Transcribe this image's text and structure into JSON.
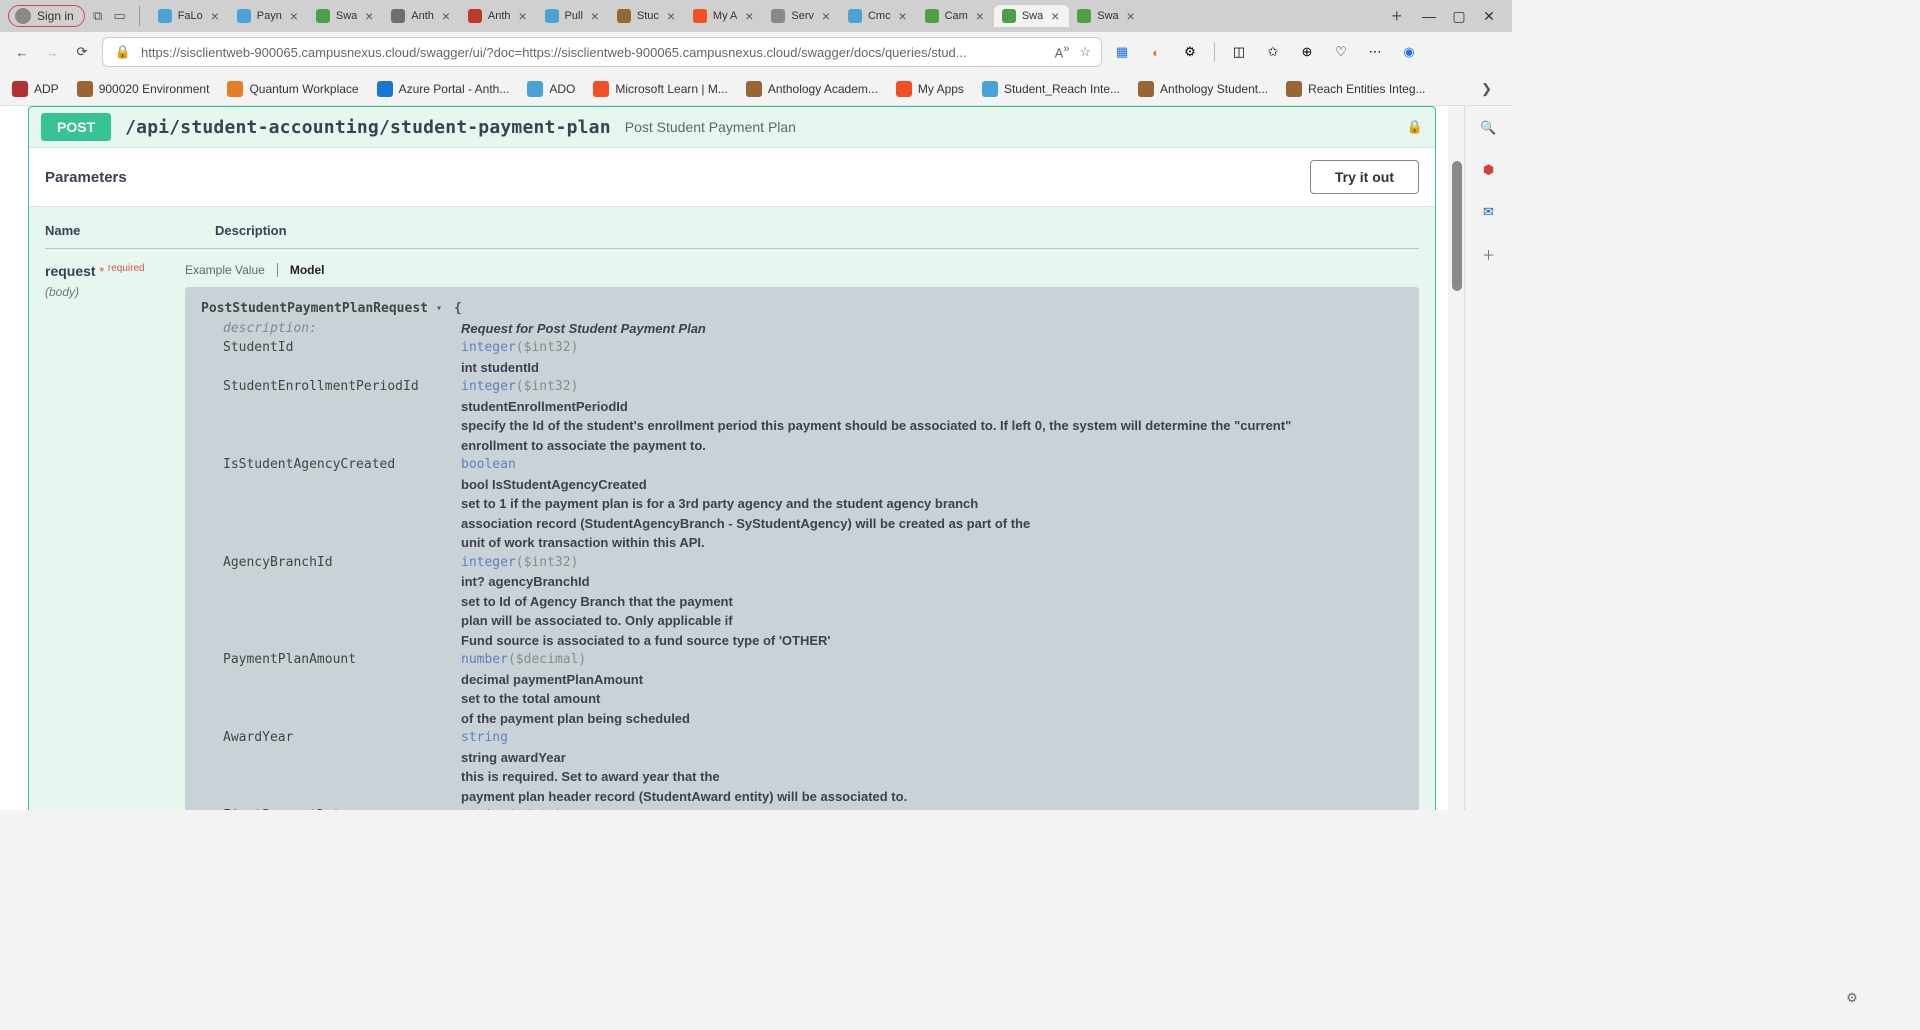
{
  "browser": {
    "signin_label": "Sign in",
    "url": "https://sisclientweb-900065.campusnexus.cloud/swagger/ui/?doc=https://sisclientweb-900065.campusnexus.cloud/swagger/docs/queries/stud...",
    "newtab_plus": "+",
    "tabs": [
      {
        "label": "FaLo",
        "favcolor": "#4aa3d8"
      },
      {
        "label": "Payn",
        "favcolor": "#4aa3d8"
      },
      {
        "label": "Swa",
        "favcolor": "#4aa047"
      },
      {
        "label": "Anth",
        "favcolor": "#6e6e6e"
      },
      {
        "label": "Anth",
        "favcolor": "#c0392b"
      },
      {
        "label": "Pull",
        "favcolor": "#4aa3d8"
      },
      {
        "label": "Stuc",
        "favcolor": "#996633"
      },
      {
        "label": "My A",
        "favcolor": "#f25022"
      },
      {
        "label": "Serv",
        "favcolor": "#888888"
      },
      {
        "label": "Cmc",
        "favcolor": "#4aa3d8"
      },
      {
        "label": "Cam",
        "favcolor": "#4aa047"
      },
      {
        "label": "Swa",
        "favcolor": "#4aa047",
        "active": true
      },
      {
        "label": "Swa",
        "favcolor": "#4aa047"
      }
    ],
    "bookmarks": [
      {
        "label": "ADP",
        "color": "#b53030"
      },
      {
        "label": "900020 Environment",
        "color": "#996633"
      },
      {
        "label": "Quantum Workplace",
        "color": "#e67e22"
      },
      {
        "label": "Azure Portal - Anth...",
        "color": "#1976d2"
      },
      {
        "label": "ADO",
        "color": "#4aa3d8"
      },
      {
        "label": "Microsoft Learn | M...",
        "color": "#f25022"
      },
      {
        "label": "Anthology Academ...",
        "color": "#996633"
      },
      {
        "label": "My Apps",
        "color": "#f25022"
      },
      {
        "label": "Student_Reach Inte...",
        "color": "#4aa3d8"
      },
      {
        "label": "Anthology Student...",
        "color": "#996633"
      },
      {
        "label": "Reach Entities Integ...",
        "color": "#996633"
      }
    ]
  },
  "swagger": {
    "method": "POST",
    "path": "/api/student-accounting/student-payment-plan",
    "summary": "Post Student Payment Plan",
    "parameters_title": "Parameters",
    "tryout_label": "Try it out",
    "col_name": "Name",
    "col_desc": "Description",
    "param": {
      "name": "request",
      "star": "*",
      "required_label": "required",
      "in": "(body)",
      "tab_example": "Example Value",
      "tab_model": "Model"
    },
    "model": {
      "title": "PostStudentPaymentPlanRequest",
      "brace": "{",
      "desc_label": "description:",
      "desc_value": "Request for Post Student Payment Plan",
      "props": [
        {
          "name": "StudentId",
          "type": "integer",
          "format": "($int32)",
          "lines": [
            "int studentId"
          ]
        },
        {
          "name": "StudentEnrollmentPeriodId",
          "type": "integer",
          "format": "($int32)",
          "lines": [
            "studentEnrollmentPeriodId",
            "specify the Id of the student's enrollment period this payment should be associated to. If left 0, the system will determine the \"current\"",
            "enrollment to associate the payment to."
          ]
        },
        {
          "name": "IsStudentAgencyCreated",
          "type": "boolean",
          "format": "",
          "lines": [
            "bool IsStudentAgencyCreated",
            "set to 1 if the payment plan is for a 3rd party agency and the student agency branch",
            "association record (StudentAgencyBranch - SyStudentAgency) will be created as part of the",
            "unit of work transaction within this API."
          ]
        },
        {
          "name": "AgencyBranchId",
          "type": "integer",
          "format": "($int32)",
          "lines": [
            "int? agencyBranchId",
            "set to Id of Agency Branch that the payment",
            "plan will be associated to. Only applicable if",
            "Fund source is associated to a fund source type of 'OTHER'"
          ]
        },
        {
          "name": "PaymentPlanAmount",
          "type": "number",
          "format": "($decimal)",
          "lines": [
            "decimal paymentPlanAmount",
            "set to the total amount",
            "of the payment plan being scheduled"
          ]
        },
        {
          "name": "AwardYear",
          "type": "string",
          "format": "",
          "lines": [
            "string awardYear",
            "this is required. Set to award year that the",
            "payment plan header record (StudentAward entity) will be associated to."
          ]
        },
        {
          "name": "FirstPaymentDate",
          "type": "string",
          "format": "($date)",
          "lines": []
        }
      ]
    }
  }
}
